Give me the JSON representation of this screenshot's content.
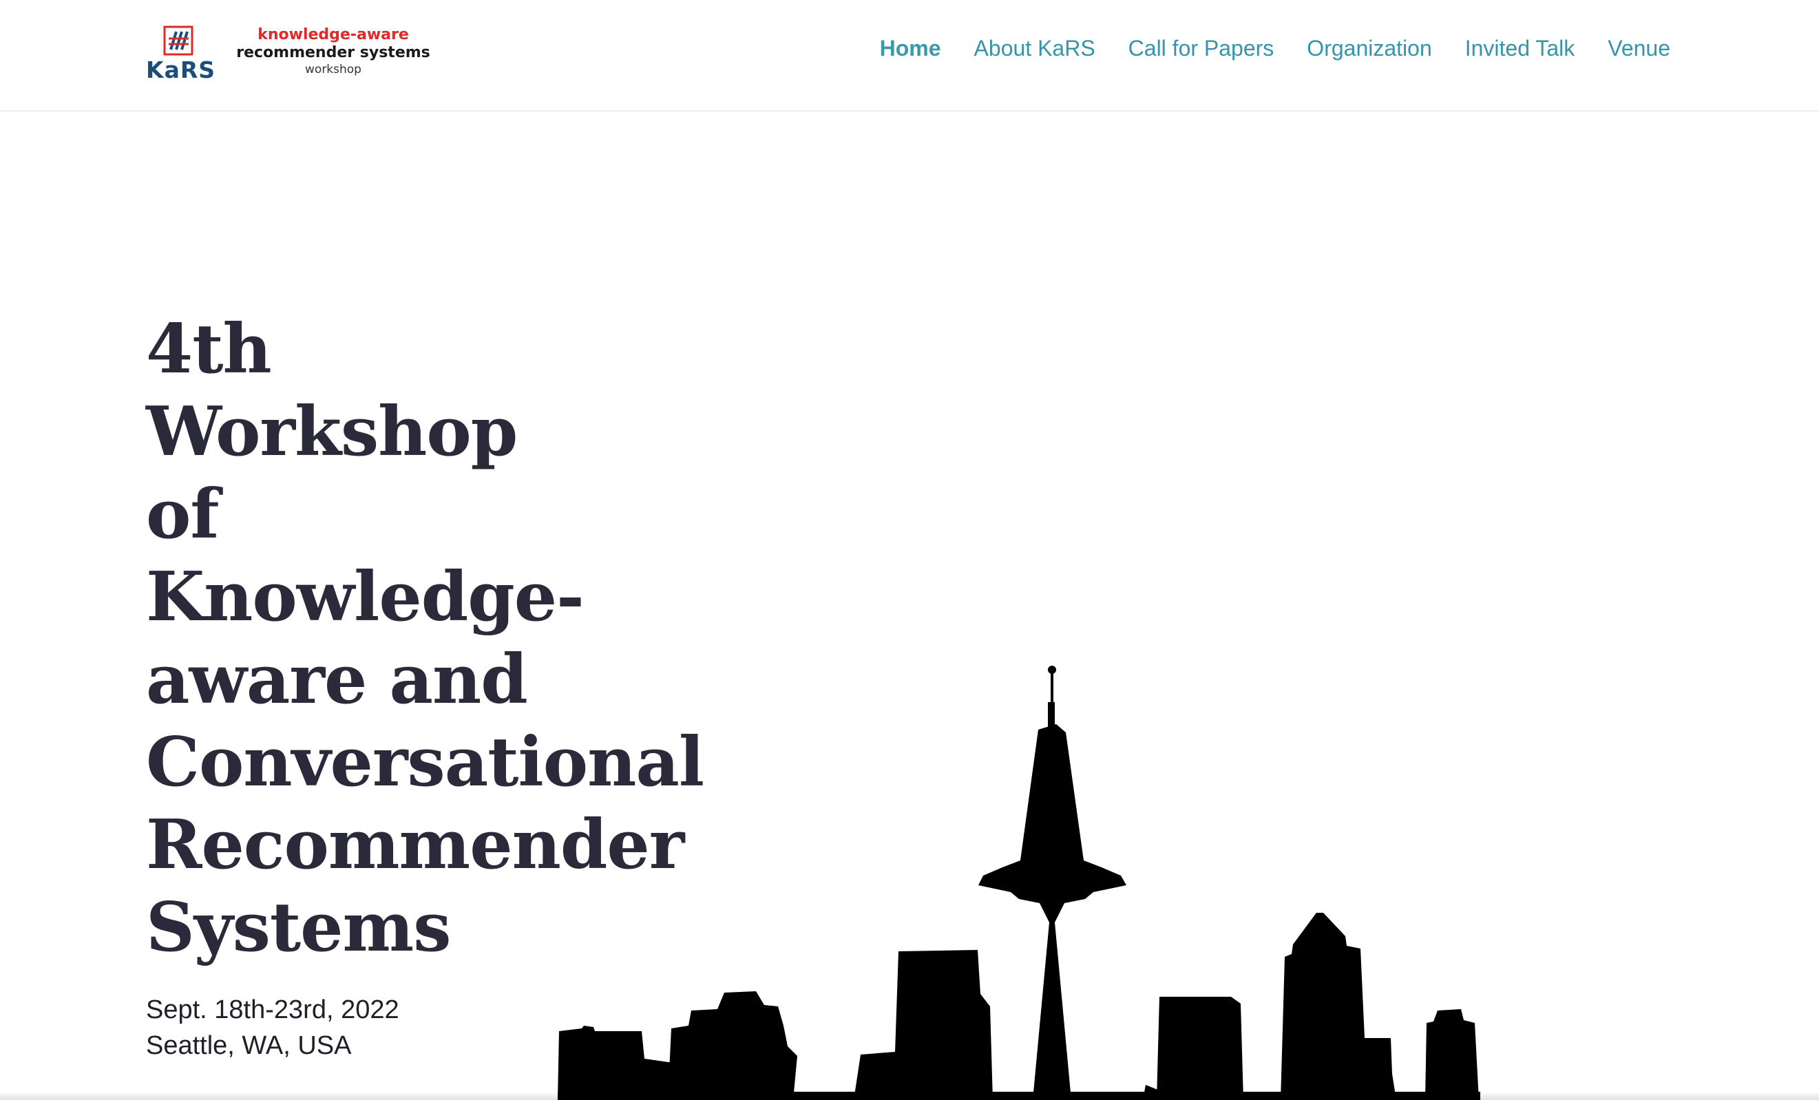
{
  "logo": {
    "mark_text": "KaRS",
    "line1": "knowledge-aware",
    "line2": "recommender systems",
    "line3": "workshop"
  },
  "nav": {
    "items": [
      {
        "label": "Home",
        "active": true
      },
      {
        "label": "About KaRS",
        "active": false
      },
      {
        "label": "Call for Papers",
        "active": false
      },
      {
        "label": "Organization",
        "active": false
      },
      {
        "label": "Invited Talk",
        "active": false
      },
      {
        "label": "Venue",
        "active": false
      }
    ]
  },
  "hero": {
    "title_lines": [
      "4th",
      "Workshop",
      "of",
      "Knowledge-",
      "aware and",
      "Conversational",
      "Recommender",
      "Systems"
    ],
    "date": "Sept. 18th-23rd, 2022",
    "location": "Seattle, WA, USA"
  },
  "colors": {
    "nav_link": "#3595a7",
    "title": "#2b2a3b",
    "logo_red": "#e02a2a",
    "logo_blue": "#1e4d7b",
    "skyline": "#000000"
  }
}
